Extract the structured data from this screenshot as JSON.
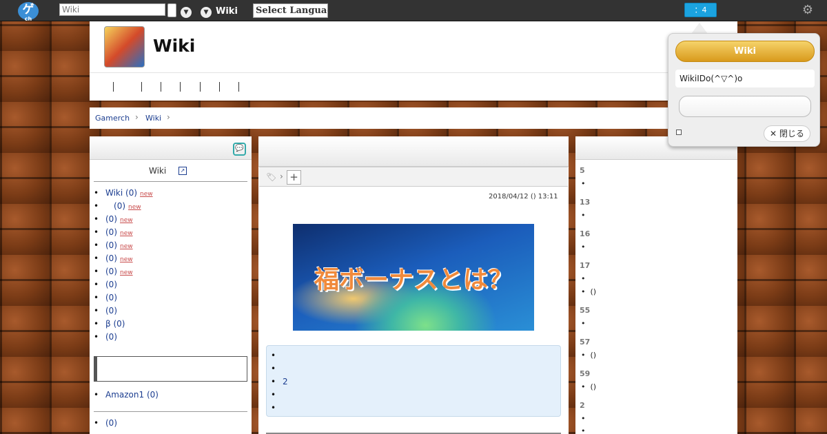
{
  "topbar": {
    "logo_text": "ゲ",
    "logo_sub": "ch",
    "search_placeholder": "Wiki",
    "wiki_link": "Wiki",
    "language_select": "Select Language",
    "notification": "：4"
  },
  "header": {
    "site_title": "Wiki"
  },
  "breadcrumb": [
    "Gamerch",
    "Wiki"
  ],
  "left_sidebar": {
    "heading": "Wiki",
    "items": [
      {
        "label": "Wiki (0)",
        "new": "new"
      },
      {
        "label": "(0)",
        "new": "new"
      },
      {
        "label": "(0)",
        "new": "new"
      },
      {
        "label": "(0)",
        "new": "new"
      },
      {
        "label": "(0)",
        "new": "new"
      },
      {
        "label": "(0)",
        "new": "new"
      },
      {
        "label": "(0)",
        "new": "new"
      },
      {
        "label": "(0)"
      },
      {
        "label": "(0)"
      },
      {
        "label": "(0)"
      },
      {
        "label": "β (0)"
      },
      {
        "label": "(0)"
      }
    ],
    "amazon_item": "Amazon1 (0)",
    "last_item": "(0)"
  },
  "main": {
    "date": "2018/04/12 () 13:11",
    "banner_text": "福ボーナスとは？",
    "toc_items": [
      "",
      "",
      "2",
      "",
      ""
    ]
  },
  "right_sidebar": {
    "sections": [
      {
        "num": "5",
        "items": [
          ""
        ]
      },
      {
        "num": "13",
        "items": [
          ""
        ]
      },
      {
        "num": "16",
        "items": [
          ""
        ]
      },
      {
        "num": "17",
        "items": [
          "",
          "()"
        ]
      },
      {
        "num": "55",
        "items": [
          ""
        ]
      },
      {
        "num": "57",
        "items": [
          "()"
        ]
      },
      {
        "num": "59",
        "items": [
          "()"
        ]
      },
      {
        "num": "2",
        "items": [
          "",
          ""
        ]
      }
    ]
  },
  "popup": {
    "button_label": "Wiki",
    "message": "WikiIDo(^▽^)o",
    "close_label": "閉じる"
  }
}
